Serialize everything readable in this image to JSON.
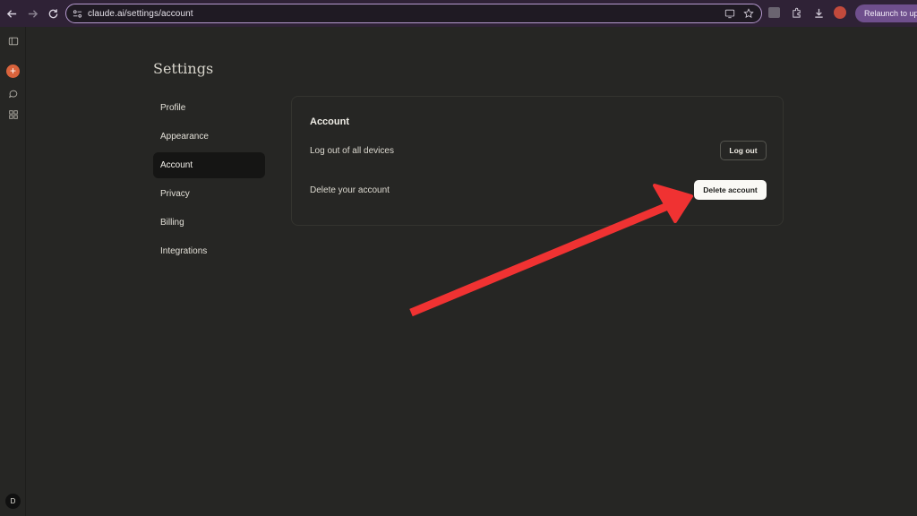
{
  "browser": {
    "url": "claude.ai/settings/account",
    "relaunch_label": "Relaunch to upd"
  },
  "rail": {
    "user_initial": "D"
  },
  "settings": {
    "title": "Settings",
    "nav": [
      {
        "label": "Profile",
        "active": false
      },
      {
        "label": "Appearance",
        "active": false
      },
      {
        "label": "Account",
        "active": true
      },
      {
        "label": "Privacy",
        "active": false
      },
      {
        "label": "Billing",
        "active": false
      },
      {
        "label": "Integrations",
        "active": false
      }
    ]
  },
  "account": {
    "heading": "Account",
    "logout_row_label": "Log out of all devices",
    "logout_button": "Log out",
    "delete_row_label": "Delete your account",
    "delete_button": "Delete account"
  },
  "colors": {
    "annotation_arrow": "#f03232",
    "accent_new_chat": "#d9633c",
    "relaunch_bg": "#6f4f8d"
  }
}
